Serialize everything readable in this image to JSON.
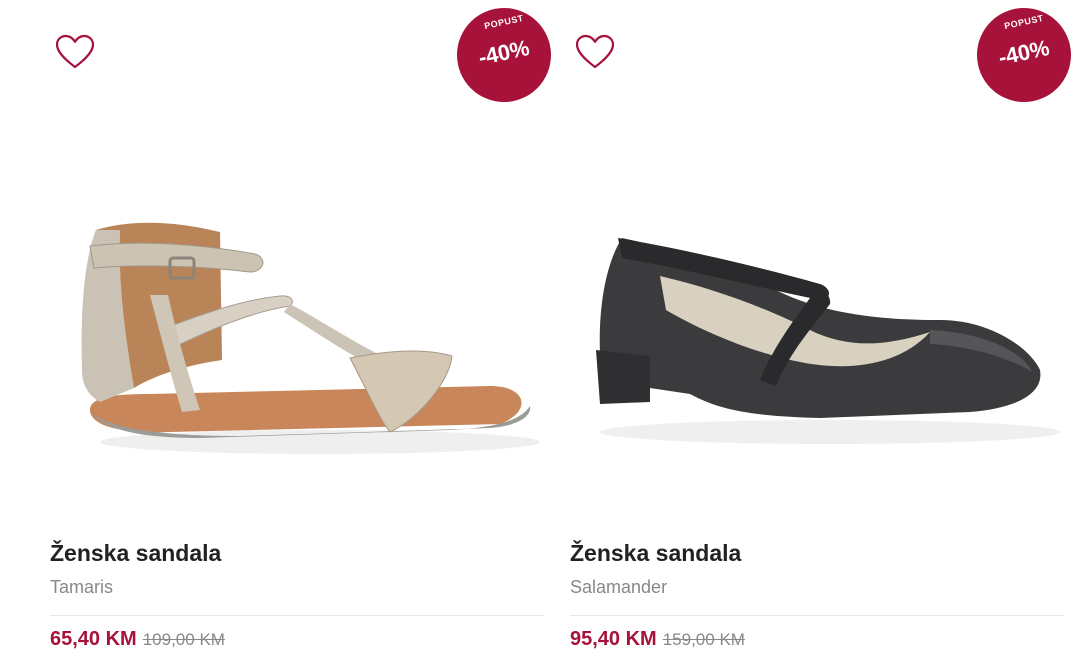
{
  "colors": {
    "accent": "#a6123a",
    "title": "#222222",
    "muted": "#888888"
  },
  "products": [
    {
      "badge_top": "POPUST",
      "badge_value": "-40%",
      "title": "Ženska sandala",
      "brand": "Tamaris",
      "price": "65,40 KM",
      "old_price": "109,00 KM",
      "favorite_icon": "heart-outline-icon"
    },
    {
      "badge_top": "POPUST",
      "badge_value": "-40%",
      "title": "Ženska sandala",
      "brand": "Salamander",
      "price": "95,40 KM",
      "old_price": "159,00 KM",
      "favorite_icon": "heart-outline-icon"
    }
  ]
}
